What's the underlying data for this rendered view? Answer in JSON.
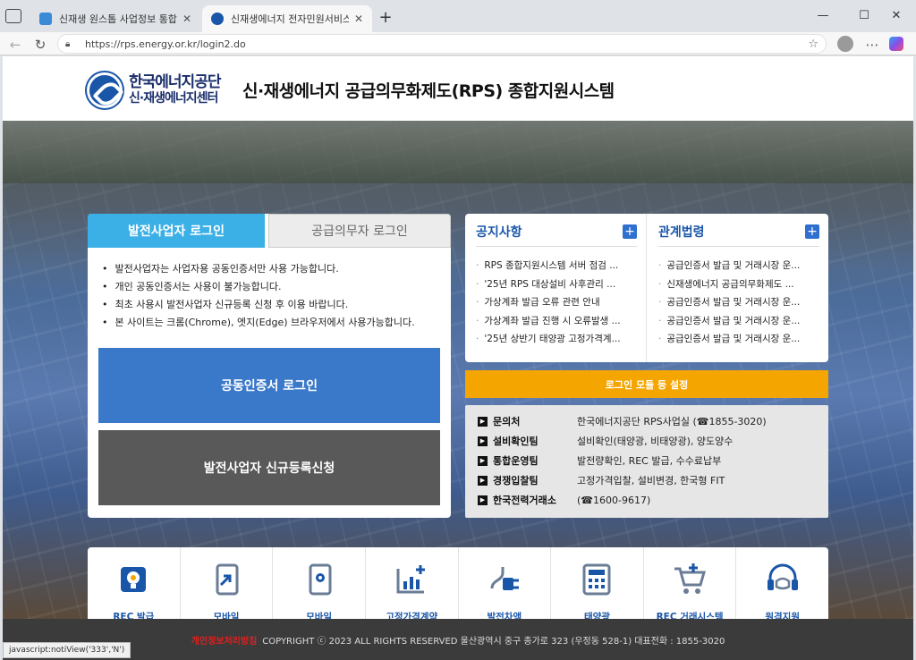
{
  "browser": {
    "tabs": [
      {
        "title": "신재생 원스톱 사업정보 통합포털",
        "color": "#3b8ad8"
      },
      {
        "title": "신재생에너지 전자민원서비스",
        "color": "#1a56a8"
      }
    ],
    "url": "https://rps.energy.or.kr/login2.do",
    "icons": {
      "new_tab": "+",
      "back": "←",
      "reload": "↻",
      "star": "☆",
      "more": "⋯",
      "min": "—",
      "max": "☐",
      "close": "✕"
    }
  },
  "header": {
    "logo_line1": "한국에너지공단",
    "logo_line2": "신·재생에너지센터",
    "title": "신·재생에너지 공급의무화제도(RPS) 종합지원시스템"
  },
  "login": {
    "tab_active": "발전사업자 로그인",
    "tab_inactive": "공급의무자 로그인",
    "notes": [
      "발전사업자는 사업자용 공동인증서만 사용 가능합니다.",
      "개인 공동인증서는 사용이 불가능합니다.",
      "최초 사용시 발전사업자 신규등록 신청 후 이용 바랍니다.",
      "본 사이트는 크롬(Chrome), 엣지(Edge) 브라우저에서 사용가능합니다."
    ],
    "cert_button": "공동인증서 로그인",
    "register_button": "발전사업자 신규등록신청"
  },
  "notices": {
    "title": "공지사항",
    "items": [
      "RPS 종합지원시스템 서버 점검 ...",
      "'25년 RPS 대상설비 사후관리 ...",
      "가상계좌 발급 오류 관련 안내",
      "가상계좌 발급 진행 시 오류발생 ...",
      "'25년 상반기 태양광 고정가격계..."
    ]
  },
  "laws": {
    "title": "관계법령",
    "items": [
      "공급인증서 발급 및 거래시장 운...",
      "신재생에너지 공급의무화제도 ...",
      "공급인증서 발급 및 거래시장 운...",
      "공급인증서 발급 및 거래시장 운...",
      "공급인증서 발급 및 거래시장 운..."
    ]
  },
  "module_button": "로그인 모듈 등 설정",
  "contacts": [
    {
      "key": "문의처",
      "value": "한국에너지공단 RPS사업실 (☎1855-3020)"
    },
    {
      "key": "설비확인팀",
      "value": "설비확인(태양광, 비태양광), 양도양수"
    },
    {
      "key": "통합운영팀",
      "value": "발전량확인, REC 발급, 수수료납부"
    },
    {
      "key": "경쟁입찰팀",
      "value": "고정가격입찰, 설비변경, 한국형 FIT"
    },
    {
      "key": "한국전력거래소",
      "value": "(☎1600-9617)"
    }
  ],
  "services": [
    {
      "label": "REC 발급\n처리 절차",
      "icon": "rec-issue-icon"
    },
    {
      "label": "모바일\n바로가기",
      "icon": "mobile-link-icon"
    },
    {
      "label": "모바일\n이용안내",
      "icon": "mobile-guide-icon"
    },
    {
      "label": "고정가격계약\n바로가기",
      "icon": "fixed-price-icon"
    },
    {
      "label": "발전차액\n바로가기",
      "icon": "plug-icon"
    },
    {
      "label": "태양광\n수익성 계산",
      "icon": "calculator-icon"
    },
    {
      "label": "REC 거래시스템\n(전력 거래소)",
      "icon": "cart-icon"
    },
    {
      "label": "원격지원\n서비스",
      "icon": "headset-icon"
    }
  ],
  "footer": {
    "privacy": "개인정보처리방침",
    "copyright": "COPYRIGHT ⓒ 2023 ALL RIGHTS RESERVED 울산광역시 중구 종가로 323 (우정동 528-1) 대표전화 : 1855-3020"
  },
  "status_bar": "javascript:notiView('333','N')",
  "colors": {
    "accent": "#3bb0e6",
    "primary": "#1a56a8",
    "orange": "#f5a500",
    "footer": "#3b3b3b"
  }
}
